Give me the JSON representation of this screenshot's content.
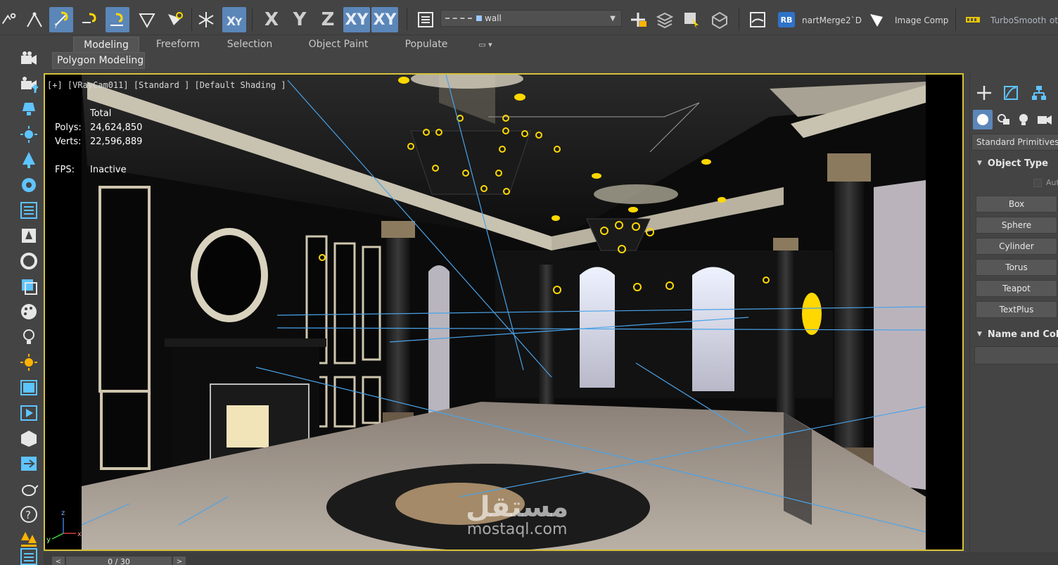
{
  "colors": {
    "ui_bg": "#444444",
    "accent_active": "#5b86b8",
    "viewport_border": "#d6c23a",
    "guide_lines": "#4aa3e8",
    "light_marker": "#ffd800"
  },
  "toolbar": {
    "icons": [
      "snap-2d-icon",
      "angle-snap-icon",
      "snap-toggle-icon",
      "percent-snap-icon",
      "spinner-snap-icon",
      "mirror-icon",
      "edit-named-selection-icon",
      "snowflake-icon",
      "constrain-xy-icon"
    ],
    "axes": [
      "X",
      "Y",
      "Z",
      "XY",
      "XY"
    ],
    "layer_value": "wall",
    "merge_label": "nartMerge2`D",
    "rb_badge": "RB",
    "image_comp_label": "Image Comp",
    "turbosmooth_label": "TurboSmooth",
    "turbosmooth_suffix": "ot"
  },
  "ribbon": {
    "tabs": [
      "Modeling",
      "Freeform",
      "Selection",
      "Object Paint",
      "Populate"
    ],
    "active_tab": "Modeling",
    "sub_panel": "Polygon Modeling",
    "more_icon": "display-menu-icon"
  },
  "left_tools": [
    "camera-icon",
    "add-camera-icon",
    "light-icon",
    "render-frame-icon",
    "sun-icon",
    "lines-icon",
    "tree-icon",
    "scene-explorer-icon",
    "list-icon",
    "material-icon",
    "bake-icon",
    "particles-icon",
    "layers-icon",
    "palette-icon",
    "bulb-icon",
    "sunlight-icon",
    "panel-icon",
    "media-icon",
    "cube-icon",
    "link-icon",
    "teapot-icon",
    "help-icon",
    "arrow-icon",
    "forest-icon",
    "menu-icon"
  ],
  "viewport": {
    "label": "[+] [VRayCam011] [Standard ] [Default Shading ]",
    "stats_header": "Total",
    "polys_label": "Polys:",
    "polys_value": "24,624,850",
    "verts_label": "Verts:",
    "verts_value": "22,596,889",
    "fps_label": "FPS:",
    "fps_value": "Inactive",
    "gizmo_z": "z",
    "gizmo_x": "x",
    "gizmo_y": "y",
    "watermark_ar": "مستقل",
    "watermark_en": "mostaql.com"
  },
  "command_panel": {
    "tabs": [
      "create-icon",
      "modify-icon",
      "hierarchy-icon"
    ],
    "categories": [
      "geometry-icon",
      "shapes-icon",
      "lights-icon",
      "cameras-icon"
    ],
    "dropdown": "Standard Primitives",
    "object_type_title": "Object Type",
    "autogrid_label": "Aut",
    "buttons": [
      "Box",
      "Sphere",
      "Cylinder",
      "Torus",
      "Teapot",
      "TextPlus"
    ],
    "name_color_title": "Name and Color"
  },
  "time_slider": {
    "value": "0 / 30",
    "prev": "<",
    "next": ">"
  }
}
